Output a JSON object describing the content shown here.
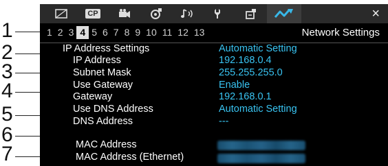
{
  "tabs": [
    {
      "icon": "picture-frame-icon",
      "label": ""
    },
    {
      "icon": "custom-picture-icon",
      "label": "CP"
    },
    {
      "icon": "movie-camera-icon",
      "label": ""
    },
    {
      "icon": "recording-setup-icon",
      "label": ""
    },
    {
      "icon": "audio-icon",
      "label": ""
    },
    {
      "icon": "wrench-icon",
      "label": ""
    },
    {
      "icon": "my-menu-icon",
      "label": ""
    },
    {
      "icon": "network-icon",
      "label": ""
    }
  ],
  "close_label": "×",
  "pages": [
    "1",
    "2",
    "3",
    "4",
    "5",
    "6",
    "7",
    "8",
    "9",
    "10",
    "11",
    "12",
    "13"
  ],
  "current_page": "4",
  "page_title": "Network Settings",
  "callouts": [
    "1",
    "2",
    "3",
    "4",
    "5",
    "6",
    "7"
  ],
  "settings": [
    {
      "label": "IP Address Settings",
      "value": "Automatic Setting"
    },
    {
      "label": "IP Address",
      "value": "192.168.0.4"
    },
    {
      "label": "Subnet Mask",
      "value": "255.255.255.0"
    },
    {
      "label": "Use Gateway",
      "value": "Enable"
    },
    {
      "label": "Gateway",
      "value": "192.168.0.1"
    },
    {
      "label": "Use DNS Address",
      "value": "Automatic Setting"
    },
    {
      "label": "DNS Address",
      "value": "---"
    },
    {
      "label": "MAC Address",
      "value": ""
    },
    {
      "label": "MAC Address (Ethernet)",
      "value": ""
    }
  ],
  "colors": {
    "value_text": "#39c4f2",
    "screen_bg": "#000000",
    "tab_active": "#3c3c3c"
  }
}
